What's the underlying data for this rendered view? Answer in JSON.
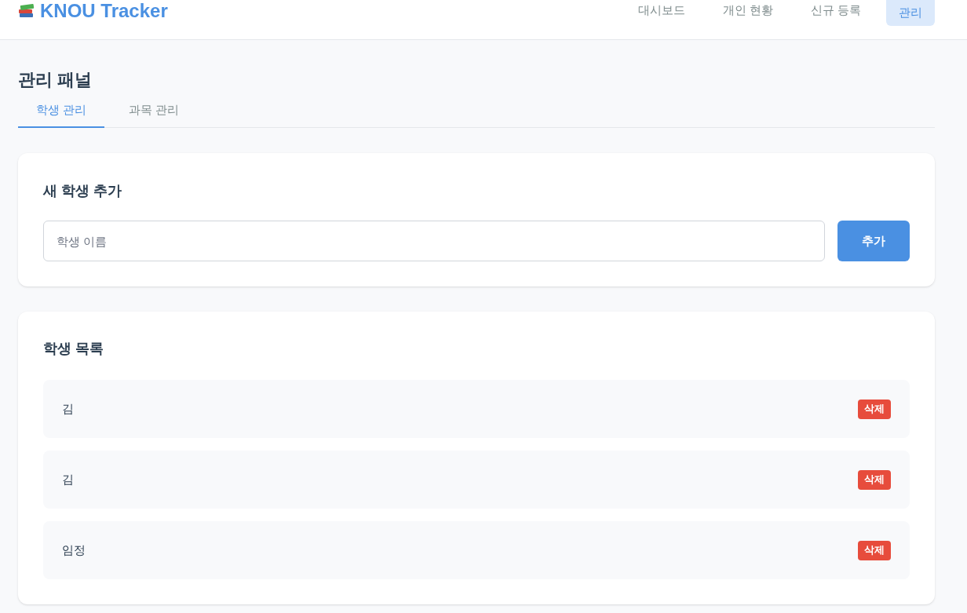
{
  "header": {
    "logo": "KNOU Tracker",
    "nav": [
      {
        "label": "대시보드",
        "selected": false
      },
      {
        "label": "개인 현황",
        "selected": false
      },
      {
        "label": "신규 등록",
        "selected": false
      },
      {
        "label": "관리",
        "selected": true
      }
    ]
  },
  "page_title": "관리 패널",
  "tabs": [
    {
      "label": "학생 관리",
      "selected": true
    },
    {
      "label": "과목 관리",
      "selected": false
    }
  ],
  "add_student": {
    "title": "새 학생 추가",
    "placeholder": "학생 이름",
    "button": "추가"
  },
  "student_list": {
    "title": "학생 목록",
    "rows": [
      {
        "name": "김",
        "delete": "삭제"
      },
      {
        "name": "김",
        "delete": "삭제"
      },
      {
        "name": "임정",
        "delete": "삭제"
      }
    ]
  }
}
